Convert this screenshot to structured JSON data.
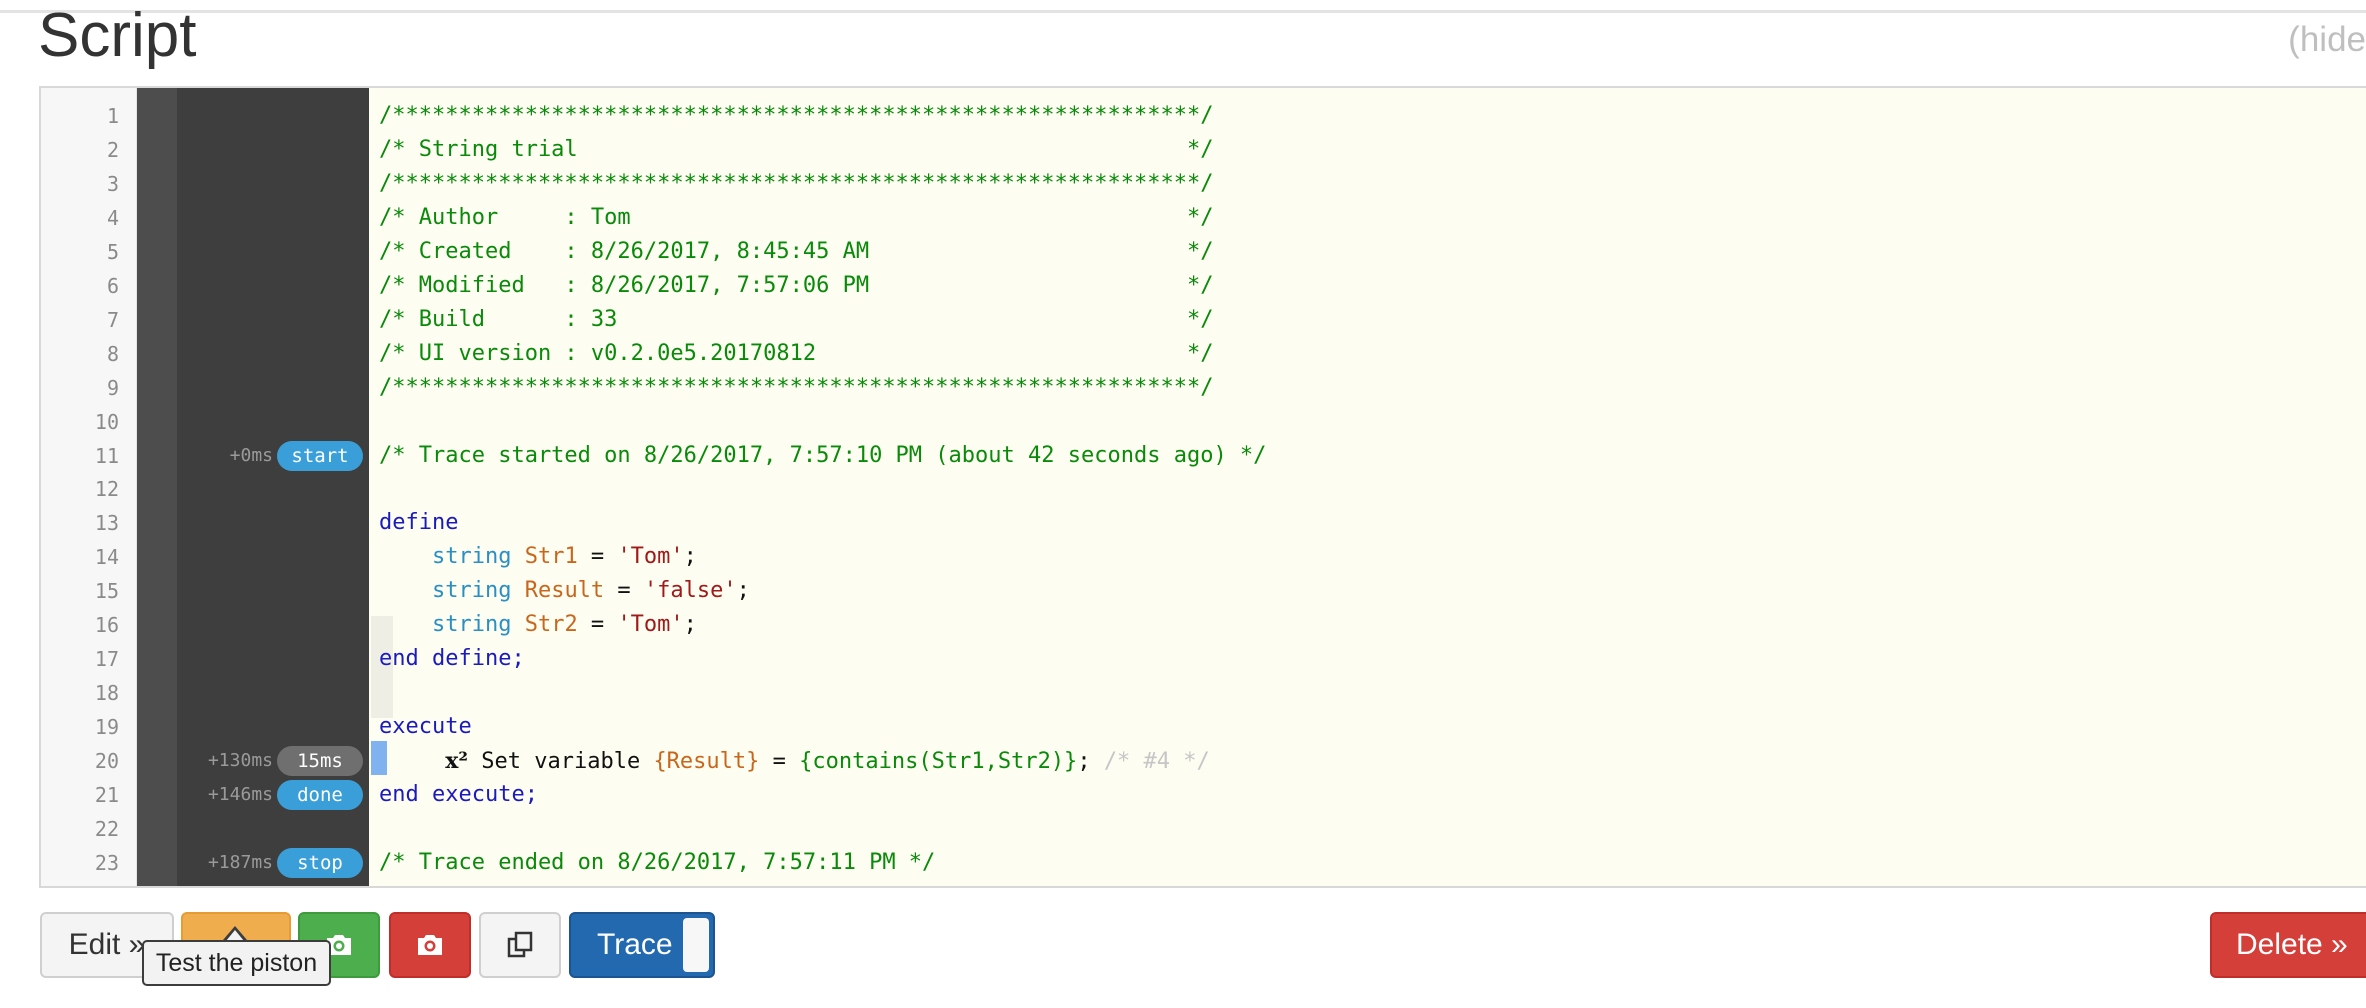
{
  "header": {
    "title": "Script",
    "hide_link": "(hide"
  },
  "lines": [
    {
      "n": "1",
      "segs": [
        {
          "c": "c",
          "t": "/*************************************************************/"
        }
      ]
    },
    {
      "n": "2",
      "segs": [
        {
          "c": "c",
          "t": "/* String trial                                              */"
        }
      ]
    },
    {
      "n": "3",
      "segs": [
        {
          "c": "c",
          "t": "/*************************************************************/"
        }
      ]
    },
    {
      "n": "4",
      "segs": [
        {
          "c": "c",
          "t": "/* Author     : Tom                                          */"
        }
      ]
    },
    {
      "n": "5",
      "segs": [
        {
          "c": "c",
          "t": "/* Created    : 8/26/2017, 8:45:45 AM                        */"
        }
      ]
    },
    {
      "n": "6",
      "segs": [
        {
          "c": "c",
          "t": "/* Modified   : 8/26/2017, 7:57:06 PM                        */"
        }
      ]
    },
    {
      "n": "7",
      "segs": [
        {
          "c": "c",
          "t": "/* Build      : 33                                           */"
        }
      ]
    },
    {
      "n": "8",
      "segs": [
        {
          "c": "c",
          "t": "/* UI version : v0.2.0e5.20170812                            */"
        }
      ]
    },
    {
      "n": "9",
      "segs": [
        {
          "c": "c",
          "t": "/*************************************************************/"
        }
      ]
    },
    {
      "n": "10",
      "segs": []
    },
    {
      "n": "11",
      "segs": [
        {
          "c": "c",
          "t": "/* Trace started on 8/26/2017, 7:57:10 PM (about 42 seconds ago) */"
        }
      ]
    },
    {
      "n": "12",
      "segs": []
    },
    {
      "n": "13",
      "segs": [
        {
          "c": "k",
          "t": "define"
        }
      ]
    },
    {
      "n": "14",
      "segs": [
        {
          "c": "p",
          "t": "    "
        },
        {
          "c": "t",
          "t": "string "
        },
        {
          "c": "v",
          "t": "Str1"
        },
        {
          "c": "p",
          "t": " = "
        },
        {
          "c": "s",
          "t": "'Tom'"
        },
        {
          "c": "p",
          "t": ";"
        }
      ]
    },
    {
      "n": "15",
      "segs": [
        {
          "c": "p",
          "t": "    "
        },
        {
          "c": "t",
          "t": "string "
        },
        {
          "c": "v",
          "t": "Result"
        },
        {
          "c": "p",
          "t": " = "
        },
        {
          "c": "s",
          "t": "'false'"
        },
        {
          "c": "p",
          "t": ";"
        }
      ]
    },
    {
      "n": "16",
      "segs": [
        {
          "c": "p",
          "t": "    "
        },
        {
          "c": "t",
          "t": "string "
        },
        {
          "c": "v",
          "t": "Str2"
        },
        {
          "c": "p",
          "t": " = "
        },
        {
          "c": "s",
          "t": "'Tom'"
        },
        {
          "c": "p",
          "t": ";"
        }
      ]
    },
    {
      "n": "17",
      "segs": [
        {
          "c": "k",
          "t": "end define;"
        }
      ]
    },
    {
      "n": "18",
      "segs": []
    },
    {
      "n": "19",
      "segs": [
        {
          "c": "k",
          "t": "execute"
        }
      ]
    },
    {
      "n": "20",
      "segs": [
        {
          "c": "p",
          "t": "     "
        },
        {
          "c": "x2",
          "t": "x²"
        },
        {
          "c": "p",
          "t": " Set variable "
        },
        {
          "c": "v",
          "t": "{Result}"
        },
        {
          "c": "p",
          "t": " = "
        },
        {
          "c": "c",
          "t": "{contains(Str1,Str2)}"
        },
        {
          "c": "p",
          "t": "; "
        },
        {
          "c": "dim",
          "t": "/* #4 */"
        }
      ]
    },
    {
      "n": "21",
      "segs": [
        {
          "c": "k",
          "t": "end execute;"
        }
      ]
    },
    {
      "n": "22",
      "segs": []
    },
    {
      "n": "23",
      "segs": [
        {
          "c": "c",
          "t": "/* Trace ended on 8/26/2017, 7:57:11 PM */"
        }
      ]
    }
  ],
  "trace": [
    {
      "line": "11",
      "time": "+0ms",
      "badge": "start",
      "color": "blue"
    },
    {
      "line": "20",
      "time": "+130ms",
      "badge": "15ms",
      "color": "gray"
    },
    {
      "line": "21",
      "time": "+146ms",
      "badge": "done",
      "color": "blue"
    },
    {
      "line": "23",
      "time": "+187ms",
      "badge": "stop",
      "color": "blue"
    }
  ],
  "toolbar": {
    "edit_label": "Edit »",
    "trace_label": "Trace",
    "delete_label": "Delete »",
    "tooltip": "Test the piston"
  },
  "colors": {
    "comment": "#0a8a0a",
    "keyword": "#1b1bbd",
    "type": "#2a8fc4",
    "variable": "#c8661c",
    "string": "#a01a1a"
  }
}
